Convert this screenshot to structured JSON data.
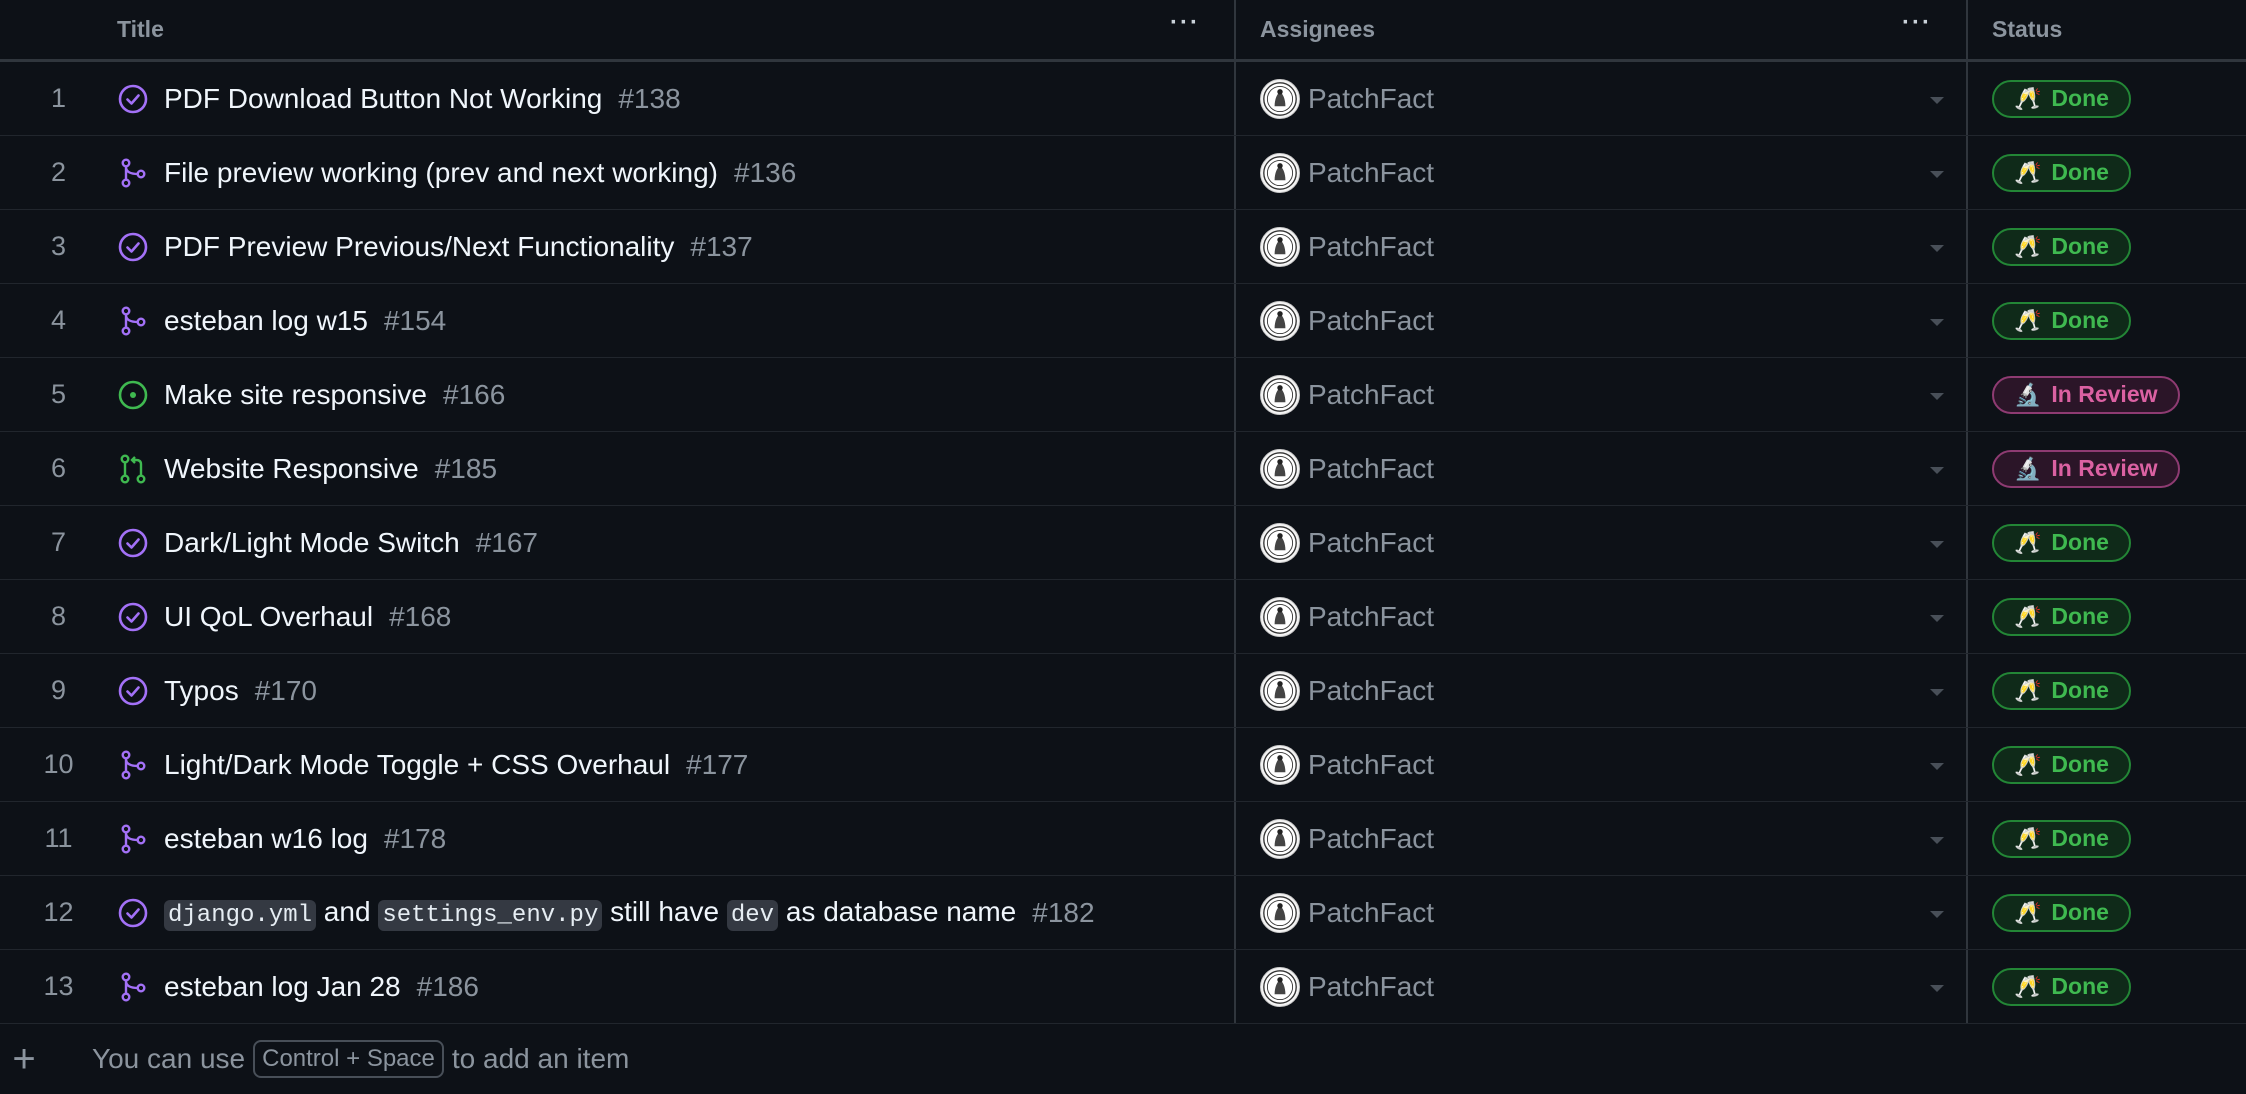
{
  "header": {
    "title_col": "Title",
    "assignees_col": "Assignees",
    "status_col": "Status",
    "menu_dots": "···"
  },
  "rows": [
    {
      "num": "1",
      "icon": "issue-closed",
      "title_parts": [
        {
          "t": "PDF Download Button Not Working"
        }
      ],
      "ref": "#138",
      "assignee": "PatchFact",
      "status": "Done",
      "status_type": "done",
      "emoji": "🥂"
    },
    {
      "num": "2",
      "icon": "pr-merged",
      "title_parts": [
        {
          "t": "File preview working (prev and next working)"
        }
      ],
      "ref": "#136",
      "assignee": "PatchFact",
      "status": "Done",
      "status_type": "done",
      "emoji": "🥂"
    },
    {
      "num": "3",
      "icon": "issue-closed",
      "title_parts": [
        {
          "t": "PDF Preview Previous/Next Functionality"
        }
      ],
      "ref": "#137",
      "assignee": "PatchFact",
      "status": "Done",
      "status_type": "done",
      "emoji": "🥂"
    },
    {
      "num": "4",
      "icon": "pr-merged",
      "title_parts": [
        {
          "t": "esteban log w15"
        }
      ],
      "ref": "#154",
      "assignee": "PatchFact",
      "status": "Done",
      "status_type": "done",
      "emoji": "🥂"
    },
    {
      "num": "5",
      "icon": "issue-open",
      "title_parts": [
        {
          "t": "Make site responsive"
        }
      ],
      "ref": "#166",
      "assignee": "PatchFact",
      "status": "In Review",
      "status_type": "review",
      "emoji": "🔬"
    },
    {
      "num": "6",
      "icon": "pr-open",
      "title_parts": [
        {
          "t": "Website Responsive"
        }
      ],
      "ref": "#185",
      "assignee": "PatchFact",
      "status": "In Review",
      "status_type": "review",
      "emoji": "🔬"
    },
    {
      "num": "7",
      "icon": "issue-closed",
      "title_parts": [
        {
          "t": "Dark/Light Mode Switch"
        }
      ],
      "ref": "#167",
      "assignee": "PatchFact",
      "status": "Done",
      "status_type": "done",
      "emoji": "🥂"
    },
    {
      "num": "8",
      "icon": "issue-closed",
      "title_parts": [
        {
          "t": "UI QoL Overhaul"
        }
      ],
      "ref": "#168",
      "assignee": "PatchFact",
      "status": "Done",
      "status_type": "done",
      "emoji": "🥂"
    },
    {
      "num": "9",
      "icon": "issue-closed",
      "title_parts": [
        {
          "t": "Typos"
        }
      ],
      "ref": "#170",
      "assignee": "PatchFact",
      "status": "Done",
      "status_type": "done",
      "emoji": "🥂"
    },
    {
      "num": "10",
      "icon": "pr-merged",
      "title_parts": [
        {
          "t": "Light/Dark Mode Toggle + CSS Overhaul"
        }
      ],
      "ref": "#177",
      "assignee": "PatchFact",
      "status": "Done",
      "status_type": "done",
      "emoji": "🥂"
    },
    {
      "num": "11",
      "icon": "pr-merged",
      "title_parts": [
        {
          "t": "esteban w16 log"
        }
      ],
      "ref": "#178",
      "assignee": "PatchFact",
      "status": "Done",
      "status_type": "done",
      "emoji": "🥂"
    },
    {
      "num": "12",
      "icon": "issue-closed",
      "title_parts": [
        {
          "t": "django.yml",
          "code": true
        },
        {
          "t": " and "
        },
        {
          "t": "settings_env.py",
          "code": true
        },
        {
          "t": " still have "
        },
        {
          "t": "dev",
          "code": true
        },
        {
          "t": " as database name"
        }
      ],
      "ref": "#182",
      "assignee": "PatchFact",
      "status": "Done",
      "status_type": "done",
      "emoji": "🥂"
    },
    {
      "num": "13",
      "icon": "pr-merged",
      "title_parts": [
        {
          "t": "esteban log Jan 28"
        }
      ],
      "ref": "#186",
      "assignee": "PatchFact",
      "status": "Done",
      "status_type": "done",
      "emoji": "🥂"
    }
  ],
  "footer": {
    "plus": "+",
    "hint_before": "You can use",
    "shortcut": "Control + Space",
    "hint_after": "to add an item"
  },
  "colors": {
    "issue_closed": "#a371f7",
    "pr_merged": "#a371f7",
    "issue_open": "#3fb950",
    "pr_open": "#3fb950"
  }
}
